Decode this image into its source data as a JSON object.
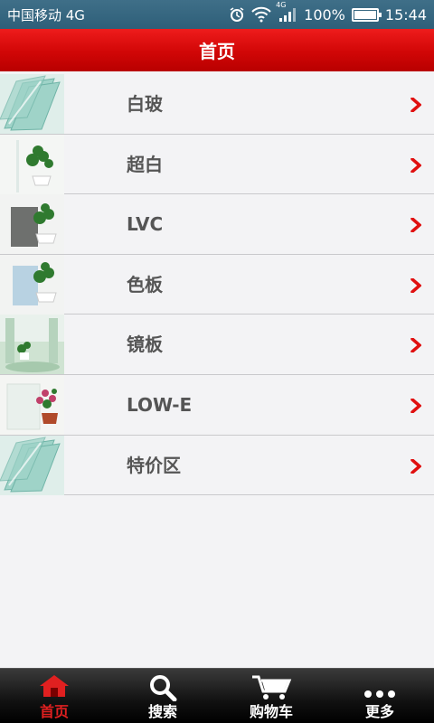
{
  "status_bar": {
    "carrier": "中国移动 4G",
    "network_badge": "4G",
    "battery_text": "100%",
    "battery_level": 1.0,
    "time": "15:44"
  },
  "title_bar": {
    "title": "首页"
  },
  "categories": [
    {
      "label": "白玻",
      "thumb_icon": "glass-stack-thumbnail"
    },
    {
      "label": "超白",
      "thumb_icon": "plant-glass-thumbnail"
    },
    {
      "label": "LVC",
      "thumb_icon": "gray-glass-plant-thumbnail"
    },
    {
      "label": "色板",
      "thumb_icon": "blue-glass-plant-thumbnail"
    },
    {
      "label": "镜板",
      "thumb_icon": "mirror-room-thumbnail"
    },
    {
      "label": "LOW-E",
      "thumb_icon": "flowers-glass-thumbnail"
    },
    {
      "label": "特价区",
      "thumb_icon": "glass-stack-thumbnail"
    }
  ],
  "tab_bar": {
    "tabs": [
      {
        "label": "首页",
        "icon": "home-icon",
        "active": true
      },
      {
        "label": "搜索",
        "icon": "search-icon",
        "active": false
      },
      {
        "label": "购物车",
        "icon": "cart-icon",
        "active": false
      },
      {
        "label": "更多",
        "icon": "more-icon",
        "active": false
      }
    ]
  },
  "colors": {
    "accent_red": "#d10606",
    "chevron_red": "#e01010",
    "status_bar": "#2e5f79",
    "row_bg": "#f3f3f5"
  }
}
